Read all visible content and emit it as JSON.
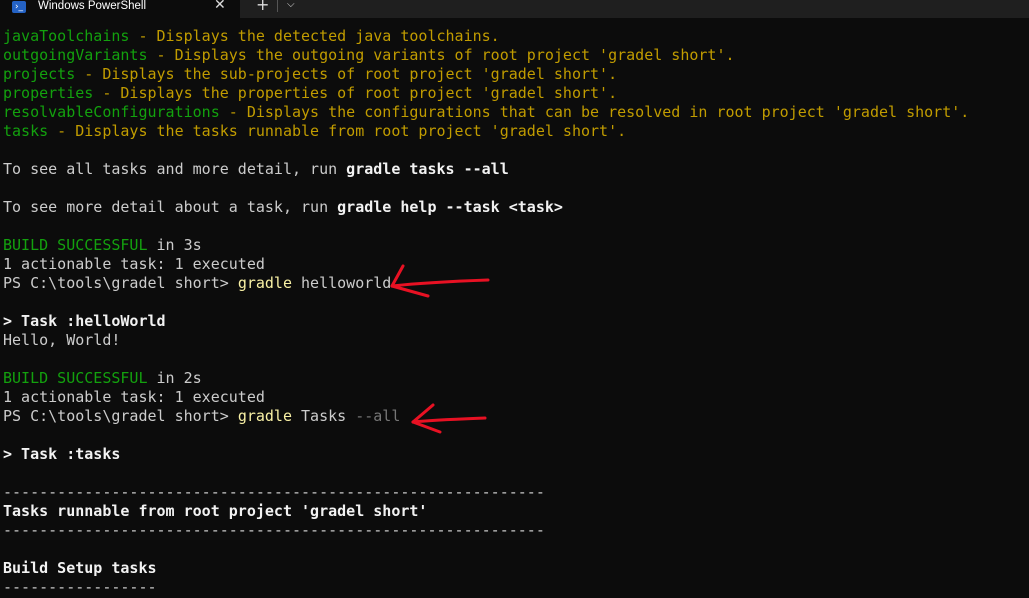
{
  "window": {
    "tab_title": "Windows PowerShell",
    "icon": "powershell-icon",
    "close_glyph": "✕",
    "new_tab_glyph": "+",
    "dropdown_glyph": "⌵"
  },
  "colors": {
    "background": "#0c0c0c",
    "yellow": "#c19c00",
    "green": "#13a10e",
    "text": "#cccccc",
    "annotation": "#e81123"
  },
  "terminal": {
    "lines": [
      [
        {
          "t": "javaToolchains",
          "c": "g"
        },
        {
          "t": " - Displays the detected java toolchains.",
          "c": "y"
        }
      ],
      [
        {
          "t": "outgoingVariants",
          "c": "g"
        },
        {
          "t": " - Displays the outgoing variants of root project 'gradel short'.",
          "c": "y"
        }
      ],
      [
        {
          "t": "projects",
          "c": "g"
        },
        {
          "t": " - Displays the sub-projects of root project 'gradel short'.",
          "c": "y"
        }
      ],
      [
        {
          "t": "properties",
          "c": "g"
        },
        {
          "t": " - Displays the properties of root project 'gradel short'.",
          "c": "y"
        }
      ],
      [
        {
          "t": "resolvableConfigurations",
          "c": "g"
        },
        {
          "t": " - Displays the configurations that can be resolved in root project 'gradel short'.",
          "c": "y"
        }
      ],
      [
        {
          "t": "tasks",
          "c": "g"
        },
        {
          "t": " - Displays the tasks runnable from root project 'gradel short'.",
          "c": "y"
        }
      ],
      [],
      [
        {
          "t": "To see all tasks and more detail, run ",
          "c": "c"
        },
        {
          "t": "gradle tasks --all",
          "c": "w"
        }
      ],
      [],
      [
        {
          "t": "To see more detail about a task, run ",
          "c": "c"
        },
        {
          "t": "gradle help --task <task>",
          "c": "w"
        }
      ],
      [],
      [
        {
          "t": "BUILD SUCCESSFUL",
          "c": "g"
        },
        {
          "t": " in 3s",
          "c": "c"
        }
      ],
      [
        {
          "t": "1 actionable task: 1 executed",
          "c": "c"
        }
      ],
      [
        {
          "t": "PS C:\\tools\\gradel short> ",
          "c": "c"
        },
        {
          "t": "gradle",
          "c": "k"
        },
        {
          "t": " helloworld",
          "c": "c"
        }
      ],
      [],
      [
        {
          "t": "> Task :helloWorld",
          "c": "w"
        }
      ],
      [
        {
          "t": "Hello, World!",
          "c": "c"
        }
      ],
      [],
      [
        {
          "t": "BUILD SUCCESSFUL",
          "c": "g"
        },
        {
          "t": " in 2s",
          "c": "c"
        }
      ],
      [
        {
          "t": "1 actionable task: 1 executed",
          "c": "c"
        }
      ],
      [
        {
          "t": "PS C:\\tools\\gradel short> ",
          "c": "c"
        },
        {
          "t": "gradle",
          "c": "k"
        },
        {
          "t": " Tasks ",
          "c": "c"
        },
        {
          "t": "--all",
          "c": "dim"
        }
      ],
      [],
      [
        {
          "t": "> Task :tasks",
          "c": "w"
        }
      ],
      [],
      [
        {
          "t": "------------------------------------------------------------",
          "c": "c"
        }
      ],
      [
        {
          "t": "Tasks runnable from root project 'gradel short'",
          "c": "w"
        }
      ],
      [
        {
          "t": "------------------------------------------------------------",
          "c": "c"
        }
      ],
      [],
      [
        {
          "t": "Build Setup tasks",
          "c": "w"
        }
      ],
      [
        {
          "t": "-----------------",
          "c": "c"
        }
      ]
    ]
  },
  "annotations": [
    "red-arrow",
    "red-arrow"
  ]
}
